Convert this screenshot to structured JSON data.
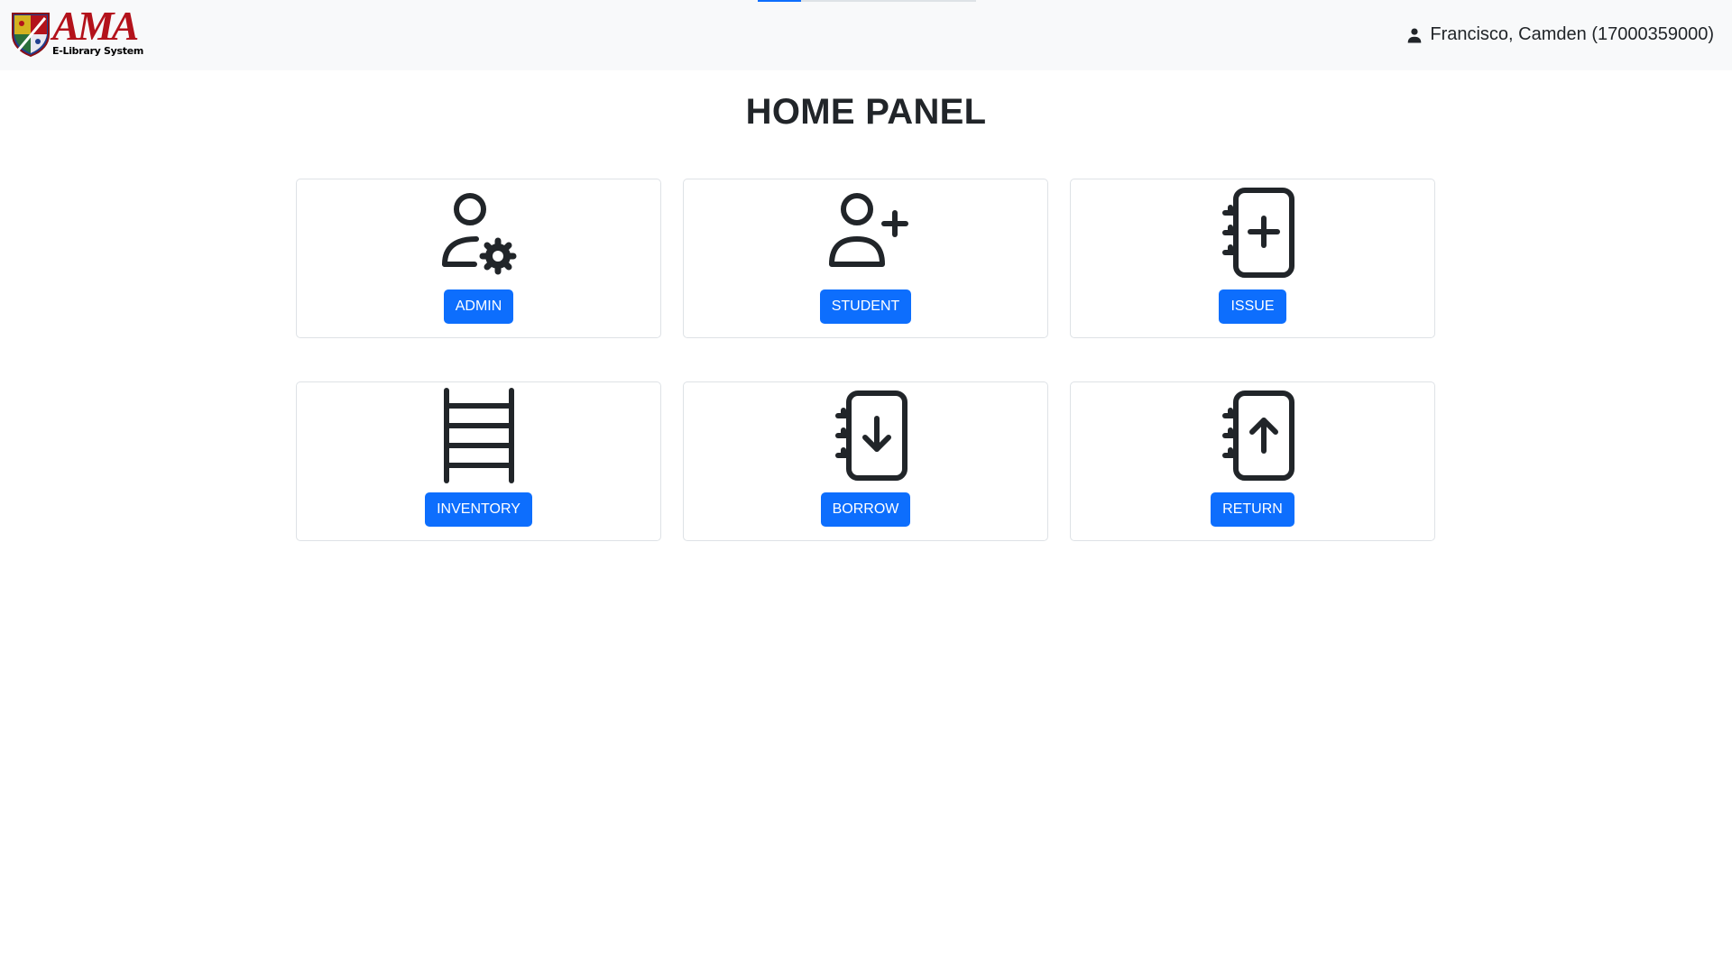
{
  "header": {
    "logo": {
      "word": "AMA",
      "subtitle": "E-Library System",
      "icon": "shield-crest-icon"
    },
    "progress": {
      "percent": 20,
      "color": "#0d6efd"
    },
    "user": {
      "icon": "person-icon",
      "name": "Francisco, Camden (17000359000)"
    }
  },
  "page": {
    "title": "HOME PANEL"
  },
  "colors": {
    "accent": "#0d6efd",
    "brand": "#b3121b",
    "navbar_bg": "#f8f9fa"
  },
  "panels": [
    {
      "label": "ADMIN",
      "icon": "user-gear-icon"
    },
    {
      "label": "STUDENT",
      "icon": "user-plus-icon"
    },
    {
      "label": "ISSUE",
      "icon": "notebook-plus-icon"
    },
    {
      "label": "INVENTORY",
      "icon": "ladder-shelf-icon"
    },
    {
      "label": "BORROW",
      "icon": "notebook-arrow-down-icon"
    },
    {
      "label": "RETURN",
      "icon": "notebook-arrow-up-icon"
    }
  ]
}
